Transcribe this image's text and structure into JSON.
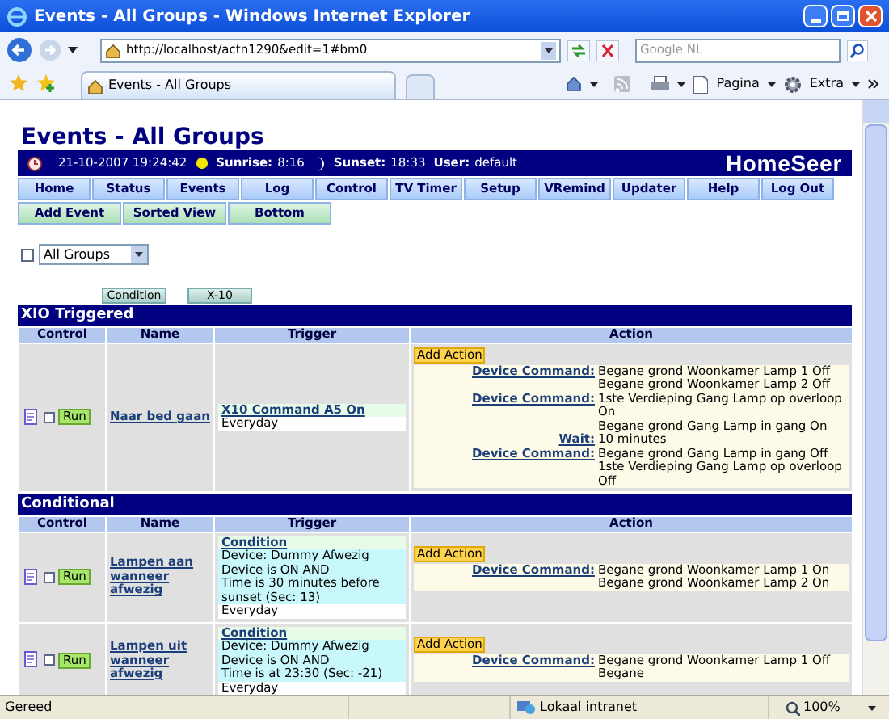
{
  "window": {
    "title": "Events - All Groups - Windows Internet Explorer"
  },
  "address_bar": {
    "url": "http://localhost/actn1290&edit=1#bm0"
  },
  "search": {
    "placeholder": "Google NL"
  },
  "tabs": [
    {
      "label": "Events - All Groups",
      "selected": true
    }
  ],
  "toolbar": [
    "Pagina",
    "Extra"
  ],
  "page": {
    "title": "Events - All Groups",
    "info": {
      "datetime": "21-10-2007 19:24:42",
      "sunrise_label": "Sunrise:",
      "sunrise": "8:16",
      "sunset_label": "Sunset:",
      "sunset": "18:33",
      "user_label": "User:",
      "user": "default"
    },
    "logo": "HomeSeer",
    "nav": [
      "Home",
      "Status",
      "Events",
      "Log",
      "Control",
      "TV Timer",
      "Setup",
      "VRemind",
      "Updater",
      "Help",
      "Log Out"
    ],
    "actions": [
      "Add Event",
      "Sorted View",
      "Bottom"
    ],
    "group_filter": {
      "checked": false,
      "value": "All Groups"
    },
    "jump_buttons": [
      "Condition",
      "X-10"
    ],
    "sections": [
      {
        "title": "XIO Triggered",
        "columns": [
          "Control",
          "Name",
          "Trigger",
          "Action"
        ],
        "events": [
          {
            "name": "Naar bed gaan",
            "checked": false,
            "run": "Run",
            "trigger": [
              {
                "kind": "link",
                "text": "X10 Command A5 On"
              },
              {
                "kind": "schedule",
                "text": "Everyday"
              }
            ],
            "add_action": "Add Action",
            "actions": [
              {
                "label": "Device Command:",
                "lines": [
                  "Begane grond Woonkamer Lamp 1 Off",
                  "Begane grond Woonkamer Lamp 2 Off"
                ]
              },
              {
                "label": "Device Command:",
                "lines": [
                  "1ste Verdieping Gang Lamp op overloop On",
                  "Begane grond Gang Lamp in gang On"
                ]
              },
              {
                "label": "Wait:",
                "lines": [
                  "10 minutes"
                ]
              },
              {
                "label": "Device Command:",
                "lines": [
                  "Begane grond Gang Lamp in gang Off",
                  "1ste Verdieping Gang Lamp op overloop Off"
                ]
              }
            ]
          }
        ]
      },
      {
        "title": "Conditional",
        "columns": [
          "Control",
          "Name",
          "Trigger",
          "Action"
        ],
        "events": [
          {
            "name": "Lampen aan wanneer afwezig",
            "checked": false,
            "run": "Run",
            "trigger": [
              {
                "kind": "link",
                "text": "Condition"
              },
              {
                "kind": "condition",
                "text": "Device: Dummy Afwezig"
              },
              {
                "kind": "condition",
                "text": "Device is ON AND"
              },
              {
                "kind": "condition",
                "text": "Time is 30 minutes before sunset (Sec: 13)"
              },
              {
                "kind": "schedule",
                "text": "Everyday"
              }
            ],
            "add_action": "Add Action",
            "actions": [
              {
                "label": "Device Command:",
                "lines": [
                  "Begane grond Woonkamer Lamp 1 On",
                  "Begane grond Woonkamer Lamp 2 On"
                ]
              }
            ]
          },
          {
            "name": "Lampen uit wanneer afwezig",
            "checked": false,
            "run": "Run",
            "trigger": [
              {
                "kind": "link",
                "text": "Condition"
              },
              {
                "kind": "condition",
                "text": "Device: Dummy Afwezig"
              },
              {
                "kind": "condition",
                "text": "Device is ON AND"
              },
              {
                "kind": "condition",
                "text": "Time is at 23:30 (Sec: -21)"
              },
              {
                "kind": "schedule",
                "text": "Everyday"
              }
            ],
            "add_action": "Add Action",
            "actions": [
              {
                "label": "Device Command:",
                "lines": [
                  "Begane grond Woonkamer Lamp 1 Off",
                  "Begane"
                ]
              }
            ]
          }
        ]
      }
    ]
  },
  "status_bar": {
    "status": "Gereed",
    "zone": "Lokaal intranet",
    "zoom": "100%"
  }
}
